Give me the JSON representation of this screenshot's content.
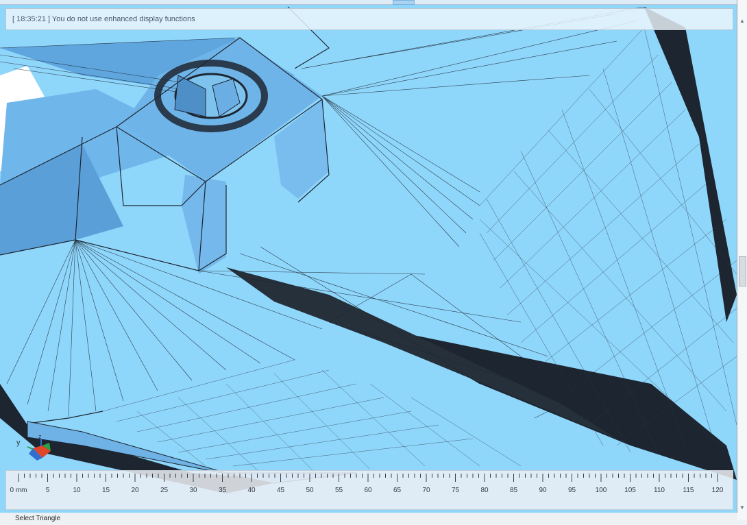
{
  "message_bar": {
    "timestamp": "[ 18:35:21 ]",
    "text": "You do not use enhanced display functions"
  },
  "ruler": {
    "unit": "mm",
    "labels": [
      "0 mm",
      "5",
      "10",
      "15",
      "20",
      "25",
      "30",
      "35",
      "40",
      "45",
      "50",
      "55",
      "60",
      "65",
      "70",
      "75",
      "80",
      "85",
      "90",
      "95",
      "100",
      "105",
      "110",
      "115",
      "120"
    ]
  },
  "axis_gizmo": {
    "y_label": "y",
    "z_label": "z"
  },
  "status": {
    "text": "Select Triangle"
  },
  "colors": {
    "mesh_face": "#8fd6fb",
    "mesh_face_dark": "#5fb2ea",
    "mesh_edge": "#1d2630",
    "axis_x": "#e0462a",
    "axis_y": "#27a244",
    "axis_z": "#2f6fd0"
  },
  "icons": {
    "scroll_up": "chevron-up-icon",
    "scroll_down": "chevron-down-icon"
  }
}
